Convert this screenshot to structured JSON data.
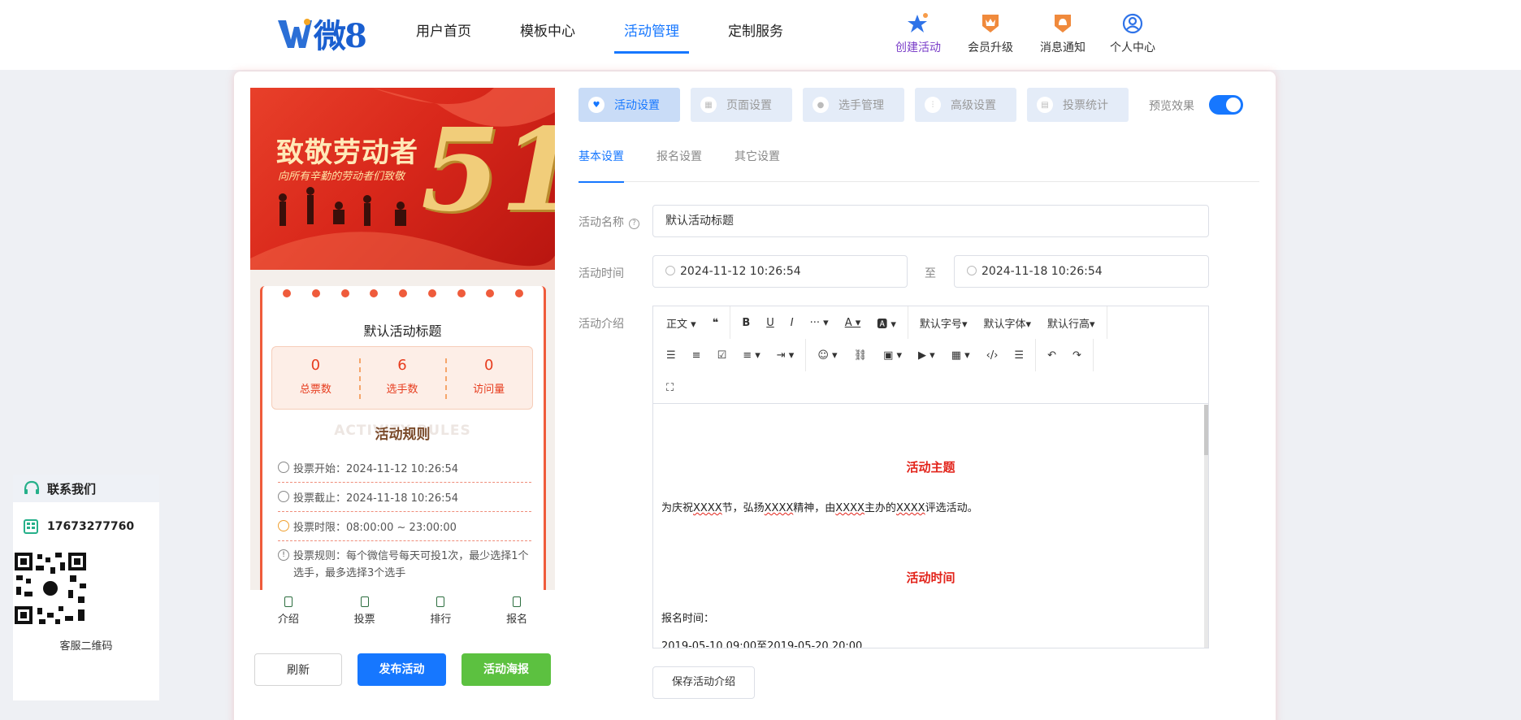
{
  "logo": {
    "text": "微8"
  },
  "nav": {
    "items": [
      "用户首页",
      "模板中心",
      "活动管理",
      "定制服务"
    ],
    "active_index": 2,
    "quick": {
      "create": "创建活动",
      "upgrade": "会员升级",
      "notify": "消息通知",
      "profile": "个人中心"
    }
  },
  "preview": {
    "banner": {
      "title": "致敬劳动者",
      "subtitle": "向所有辛勤的劳动者们致敬",
      "number": "51"
    },
    "activity_title": "默认活动标题",
    "stats": [
      {
        "value": "0",
        "label": "总票数"
      },
      {
        "value": "6",
        "label": "选手数"
      },
      {
        "value": "0",
        "label": "访问量"
      }
    ],
    "rules_bg": "ACTIVITY RULES",
    "rules_heading": "活动规则",
    "rules": [
      "投票开始：2024-11-12 10:26:54",
      "投票截止：2024-11-18 10:26:54",
      "投票时限：08:00:00 ~ 23:00:00",
      "投票规则：每个微信号每天可投1次，最少选择1个选手，最多选择3个选手"
    ],
    "tabs": [
      "介绍",
      "投票",
      "排行",
      "报名"
    ],
    "buttons": {
      "refresh": "刷新",
      "publish": "发布活动",
      "poster": "活动海报"
    }
  },
  "settings": {
    "tabs": [
      "活动设置",
      "页面设置",
      "选手管理",
      "高级设置",
      "投票统计"
    ],
    "active_tab": 0,
    "preview_label": "预览效果",
    "preview_on": true,
    "subtabs": [
      "基本设置",
      "报名设置",
      "其它设置"
    ],
    "active_subtab": 0,
    "form": {
      "name_label": "活动名称",
      "name_value": "默认活动标题",
      "time_label": "活动时间",
      "start": "2024-11-12 10:26:54",
      "separator": "至",
      "end": "2024-11-18 10:26:54",
      "intro_label": "活动介绍"
    },
    "editor": {
      "toolbar": {
        "paragraph": "正文",
        "more": "···",
        "font_size": "默认字号",
        "font_family": "默认字体",
        "line_height": "默认行高"
      },
      "content": {
        "heading1": "活动主题",
        "para1_parts": [
          "为庆祝",
          "XXXX",
          "节，弘扬",
          "XXXX",
          "精神，由",
          "XXXX",
          "主办的",
          "XXXX",
          "评选活动。"
        ],
        "heading2": "活动时间",
        "para2": "报名时间：",
        "para3": "2019-05-10 09:00至2019-05-20 20:00"
      }
    },
    "save_button": "保存活动介绍"
  },
  "contact": {
    "title": "联系我们",
    "phone": "17673277760",
    "qr_caption": "客服二维码"
  },
  "colors": {
    "primary": "#1677ff",
    "green": "#5cc140",
    "red": "#e2231a"
  }
}
